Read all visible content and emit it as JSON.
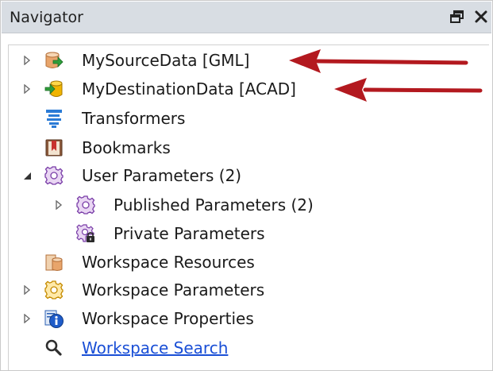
{
  "panel": {
    "title": "Navigator"
  },
  "tree": {
    "source_data": "MySourceData [GML]",
    "destination_data": "MyDestinationData [ACAD]",
    "transformers": "Transformers",
    "bookmarks": "Bookmarks",
    "user_parameters": "User Parameters (2)",
    "published_parameters": "Published Parameters (2)",
    "private_parameters": "Private Parameters",
    "workspace_resources": "Workspace Resources",
    "workspace_parameters": "Workspace Parameters",
    "workspace_properties": "Workspace Properties",
    "workspace_search": "Workspace Search"
  },
  "annotations": {
    "arrow_color": "#b3191f"
  },
  "icons": [
    "float-window-icon",
    "close-icon",
    "expand-arrow-icon",
    "collapse-arrow-icon",
    "source-database-icon",
    "destination-database-icon",
    "transformers-icon",
    "bookmarks-icon",
    "gear-icon",
    "locked-gear-icon",
    "resources-icon",
    "info-icon",
    "search-icon"
  ]
}
